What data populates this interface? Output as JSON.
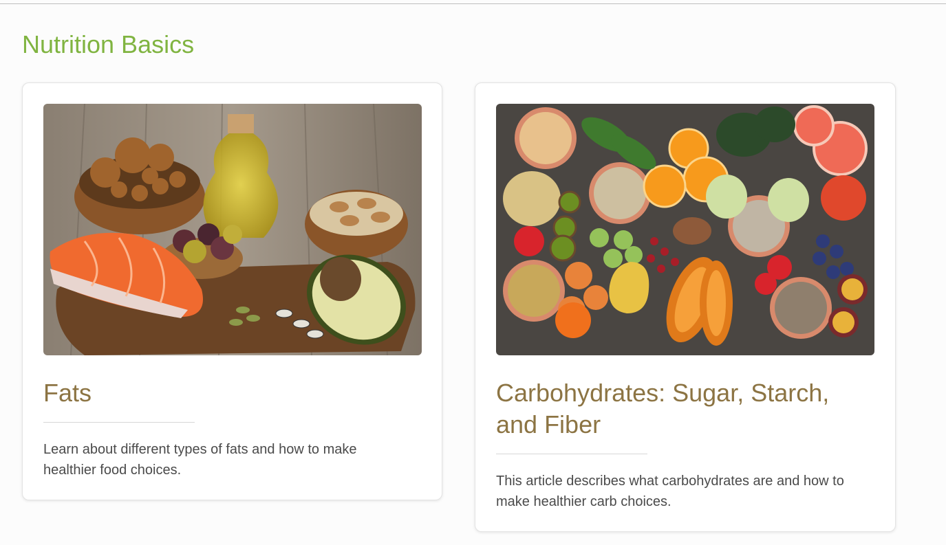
{
  "page": {
    "title": "Nutrition Basics",
    "accent_color": "#80b441",
    "card_title_color": "#8c7443"
  },
  "cards": [
    {
      "title": "Fats",
      "description": "Learn about different types of fats and how to make healthier food choices.",
      "image": "fats-food-photo"
    },
    {
      "title": "Carbohydrates: Sugar, Starch, and Fiber",
      "description": "This article describes what carbohydrates are and how to make healthier carb choices.",
      "image": "carbohydrates-food-photo"
    }
  ]
}
